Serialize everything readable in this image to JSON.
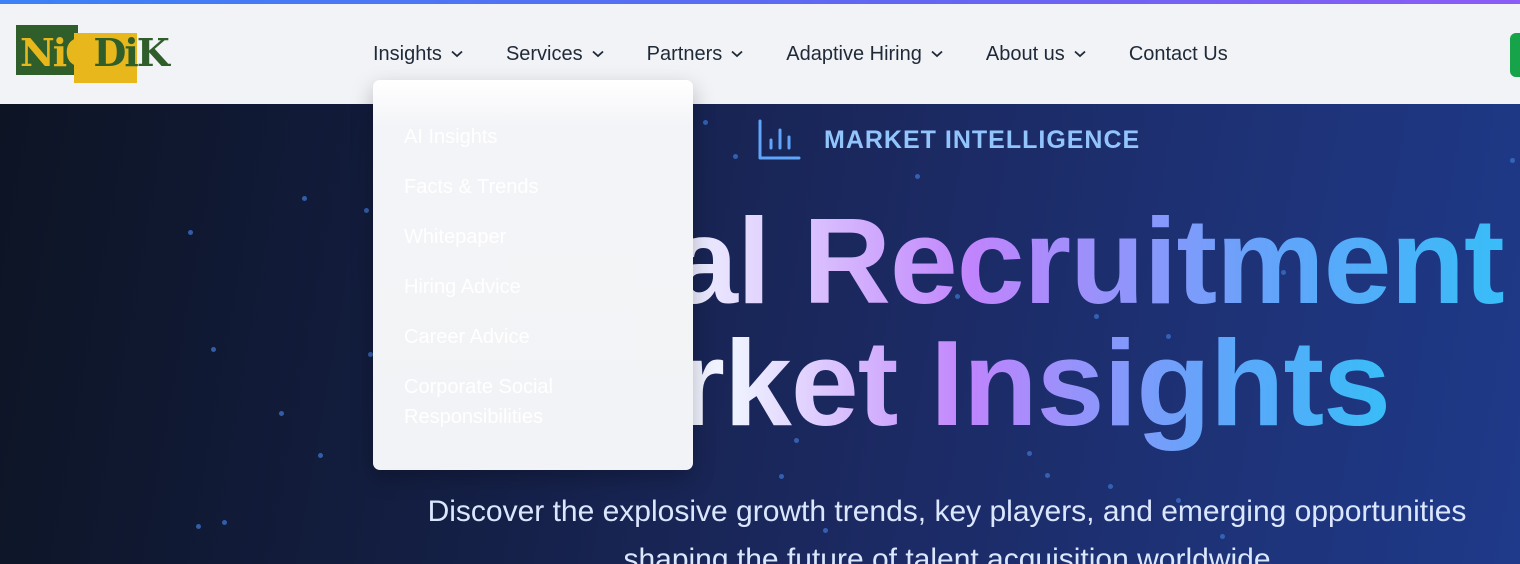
{
  "logo": {
    "text_first": "NiC",
    "text_second": "DiK",
    "colors": {
      "green": "#2f5e2a",
      "yellow": "#e7b71c"
    }
  },
  "nav": {
    "items": [
      {
        "label": "Insights",
        "has_dropdown": true
      },
      {
        "label": "Services",
        "has_dropdown": true
      },
      {
        "label": "Partners",
        "has_dropdown": true
      },
      {
        "label": "Adaptive Hiring",
        "has_dropdown": true
      },
      {
        "label": "About us",
        "has_dropdown": true
      },
      {
        "label": "Contact Us",
        "has_dropdown": false
      }
    ],
    "cta_color": "#16a34a"
  },
  "dropdown": {
    "parent": "Insights",
    "items": [
      "AI Insights",
      "Facts & Trends",
      "Whitepaper",
      "Hiring Advice",
      "Career Advice",
      "Corporate Social Responsibilities"
    ]
  },
  "hero": {
    "eyebrow_icon": "bar-chart-icon",
    "eyebrow": "MARKET INTELLIGENCE",
    "headline_line1": "Global Recruitment",
    "headline_line2": "Market Insights",
    "subtitle": "Discover the explosive growth trends, key players, and emerging opportunities shaping the future of talent acquisition worldwide",
    "accent_colors": {
      "purple": "#c084fc",
      "blue": "#60a5fa",
      "eyebrow": "#93c5fd"
    }
  }
}
